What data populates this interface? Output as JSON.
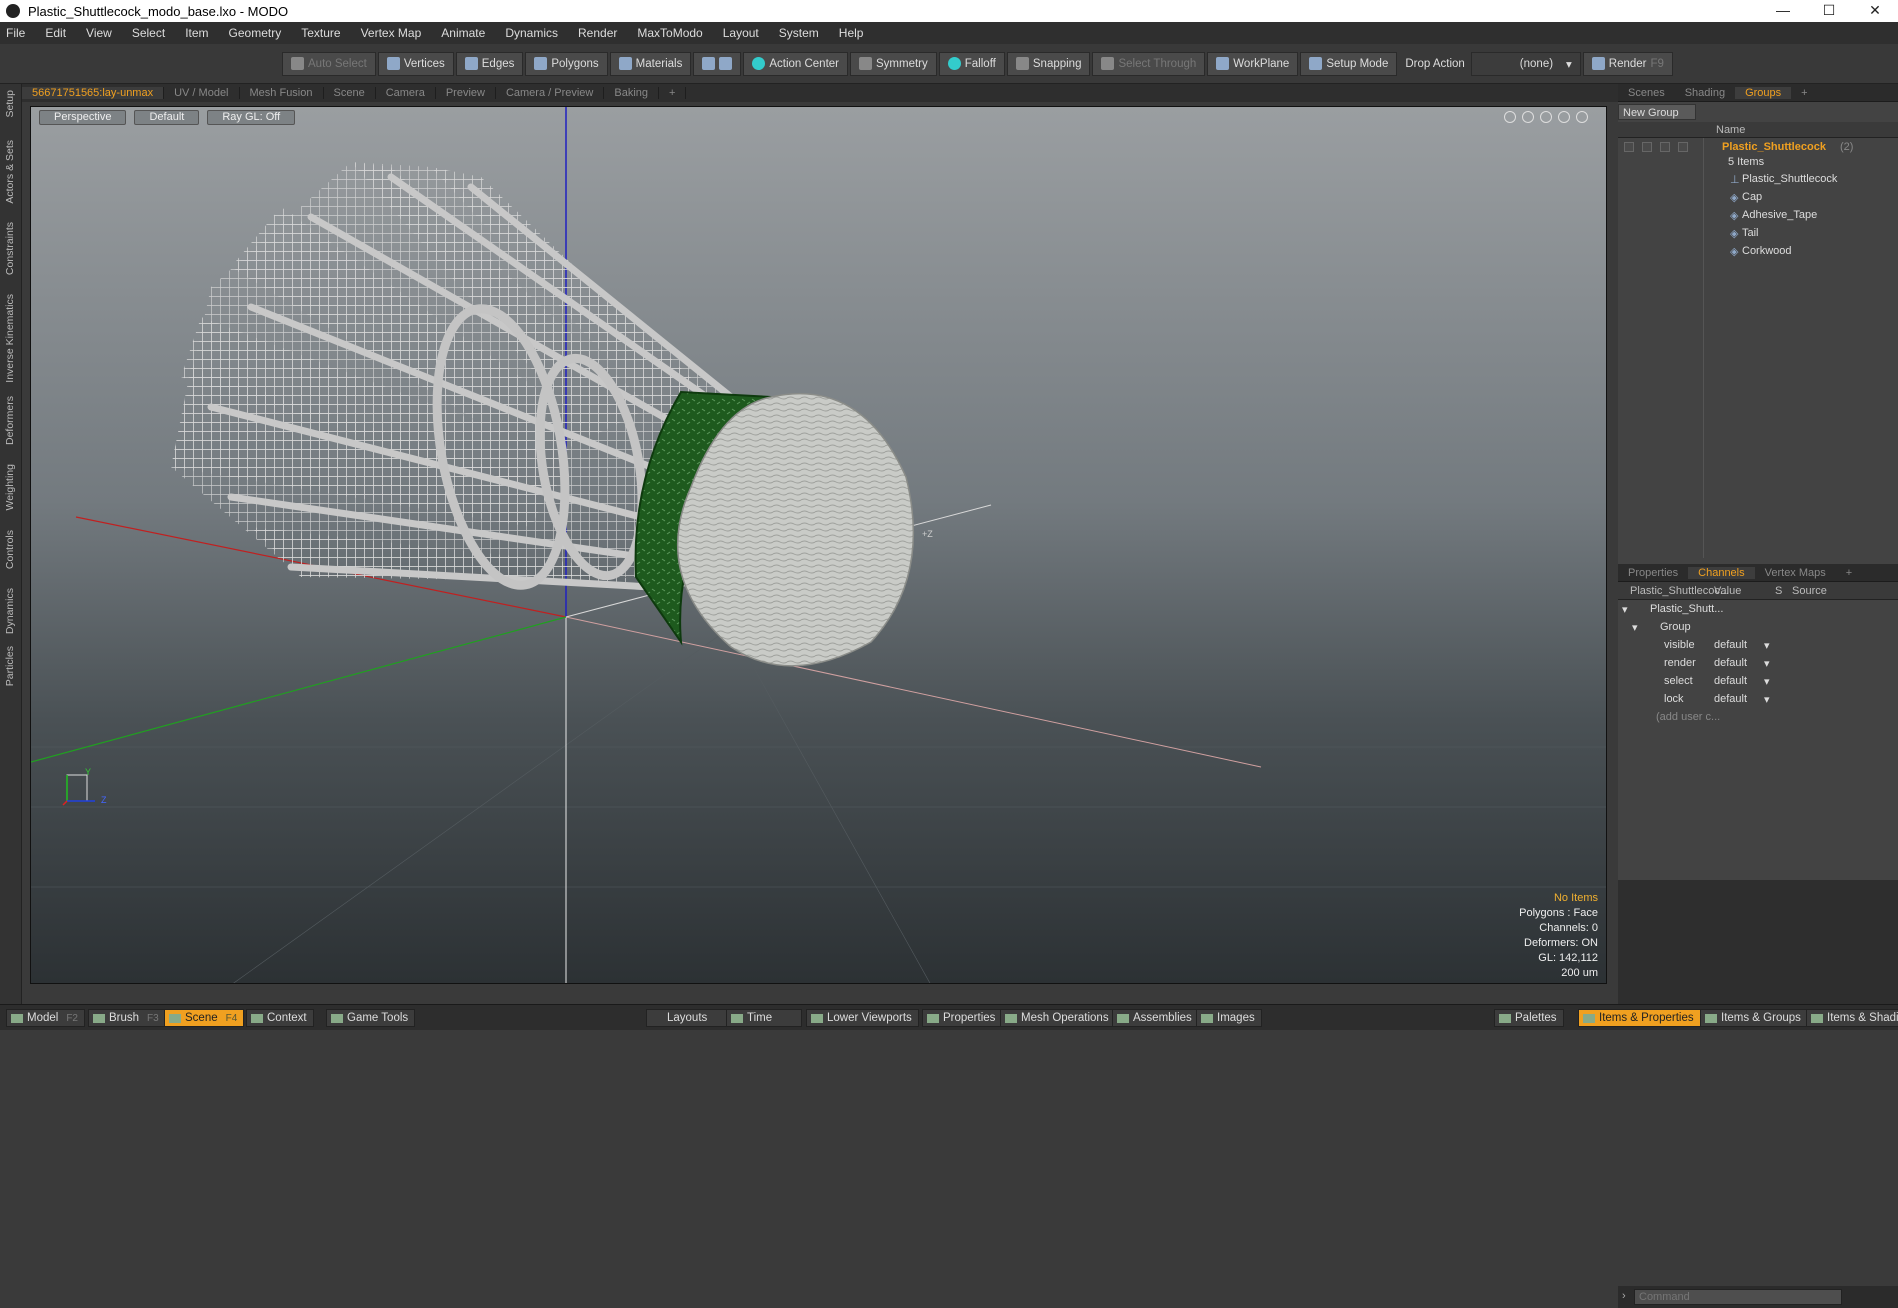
{
  "window": {
    "title": "Plastic_Shuttlecock_modo_base.lxo - MODO"
  },
  "menu": [
    "File",
    "Edit",
    "View",
    "Select",
    "Item",
    "Geometry",
    "Texture",
    "Vertex Map",
    "Animate",
    "Dynamics",
    "Render",
    "MaxToModo",
    "Layout",
    "System",
    "Help"
  ],
  "toolbar": {
    "auto_select": "Auto Select",
    "vertices": "Vertices",
    "edges": "Edges",
    "polygons": "Polygons",
    "materials": "Materials",
    "action_center": "Action Center",
    "symmetry": "Symmetry",
    "falloff": "Falloff",
    "snapping": "Snapping",
    "select_through": "Select Through",
    "workplane": "WorkPlane",
    "setup_mode": "Setup Mode",
    "drop_action": "Drop Action",
    "drop_value": "(none)",
    "render": "Render",
    "render_key": "F9"
  },
  "left_tabs": [
    "Setup",
    "Actors & Sets",
    "Constraints",
    "Inverse Kinematics",
    "Deformers",
    "Weighting",
    "Controls",
    "Dynamics",
    "Particles"
  ],
  "view_tabs": [
    "56671751565:lay-unmax",
    "UV / Model",
    "Mesh Fusion",
    "Scene",
    "Camera",
    "Preview",
    "Camera / Preview",
    "Baking",
    "+"
  ],
  "viewport": {
    "perspective": "Perspective",
    "shading": "Default",
    "raygl": "Ray GL: Off",
    "axis_label": "+Z",
    "gizmo_y": "Y",
    "gizmo_z": "Z",
    "info": {
      "items": "No Items",
      "polygons": "Polygons : Face",
      "channels": "Channels: 0",
      "deformers": "Deformers: ON",
      "gl": "GL: 142,112",
      "scale": "200 um"
    }
  },
  "groups_panel": {
    "tabs": [
      "Scenes",
      "Shading",
      "Groups",
      "+"
    ],
    "new_group": "New Group",
    "col_name": "Name",
    "group_name": "Plastic_Shuttlecock",
    "group_count": "(2)",
    "group_items": "5 Items",
    "children": [
      "Plastic_Shuttlecock",
      "Cap",
      "Adhesive_Tape",
      "Tail",
      "Corkwood"
    ]
  },
  "channels_panel": {
    "tabs": [
      "Properties",
      "Channels",
      "Vertex Maps",
      "+"
    ],
    "col_item": "Plastic_Shuttlecoc...",
    "col_value": "Value",
    "col_s": "S",
    "col_source": "Source",
    "root": "Plastic_Shutt...",
    "group": "Group",
    "rows": [
      {
        "name": "visible",
        "value": "default"
      },
      {
        "name": "render",
        "value": "default"
      },
      {
        "name": "select",
        "value": "default"
      },
      {
        "name": "lock",
        "value": "default"
      }
    ],
    "add_user": "(add user c...",
    "command_placeholder": "Command"
  },
  "bottom": {
    "model": "Model",
    "model_key": "F2",
    "brush": "Brush",
    "brush_key": "F3",
    "scene": "Scene",
    "scene_key": "F4",
    "context": "Context",
    "game_tools": "Game Tools",
    "layouts": "Layouts",
    "time": "Time",
    "lower_viewports": "Lower Viewports",
    "properties": "Properties",
    "mesh_operations": "Mesh Operations",
    "assemblies": "Assemblies",
    "images": "Images",
    "palettes": "Palettes",
    "items_properties": "Items & Properties",
    "items_groups": "Items & Groups",
    "items_shading": "Items & Shadin"
  },
  "colors": {
    "accent": "#f0a020",
    "tape": "#1e5a1e",
    "cork": "#c9cbc7"
  }
}
